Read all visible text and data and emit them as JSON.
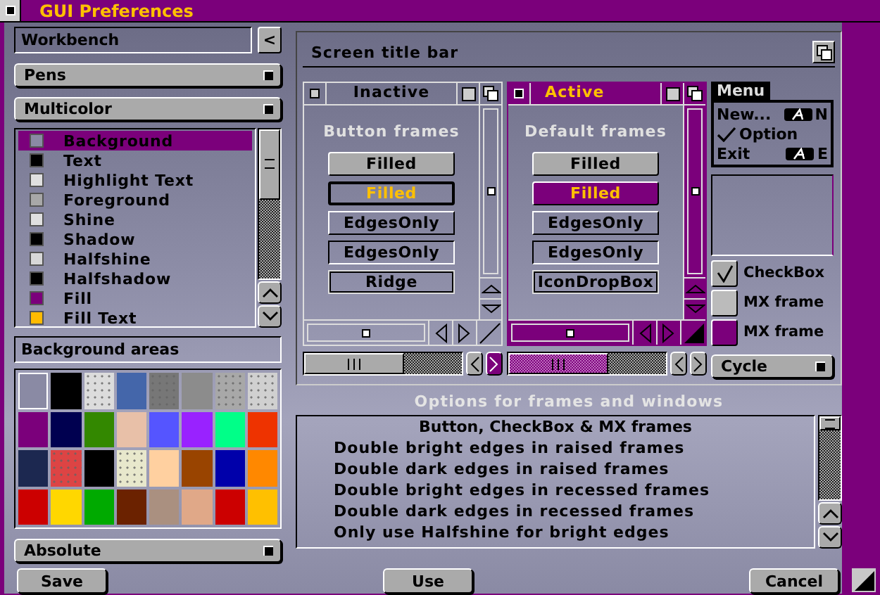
{
  "window": {
    "title": "GUI Preferences"
  },
  "theme": {
    "value": "Workbench",
    "button": "<"
  },
  "pens_cycle": "Pens",
  "mode_cycle": "Multicolor",
  "pens": [
    {
      "name": "Background",
      "color": "#8a8aa4",
      "selected": true
    },
    {
      "name": "Text",
      "color": "#000000",
      "selected": false
    },
    {
      "name": "Highlight Text",
      "color": "#e0e0e0",
      "selected": false
    },
    {
      "name": "Foreground",
      "color": "#a8a8a8",
      "selected": false
    },
    {
      "name": "Shine",
      "color": "#e0e0e0",
      "selected": false
    },
    {
      "name": "Shadow",
      "color": "#000000",
      "selected": false
    },
    {
      "name": "Halfshine",
      "color": "#d8d8d8",
      "selected": false
    },
    {
      "name": "Halfshadow",
      "color": "#000000",
      "selected": false
    },
    {
      "name": "Fill",
      "color": "#7b007b",
      "selected": false
    },
    {
      "name": "Fill Text",
      "color": "#ffbb00",
      "selected": false
    }
  ],
  "background_areas": {
    "label": "Background areas",
    "swatches": [
      {
        "color": "#8a8aa4",
        "dotted": false,
        "selected": true
      },
      {
        "color": "#000000",
        "dotted": false,
        "selected": false
      },
      {
        "color": "#dcdcdc",
        "dotted": true,
        "selected": false
      },
      {
        "color": "#4466aa",
        "dotted": false,
        "selected": false
      },
      {
        "color": "#777777",
        "dotted": true,
        "selected": false
      },
      {
        "color": "#8c8c8c",
        "dotted": false,
        "selected": false
      },
      {
        "color": "#a8a8a8",
        "dotted": true,
        "selected": false
      },
      {
        "color": "#d0d0d0",
        "dotted": true,
        "selected": false
      },
      {
        "color": "#7b007b",
        "dotted": false,
        "selected": false
      },
      {
        "color": "#000050",
        "dotted": false,
        "selected": false
      },
      {
        "color": "#338800",
        "dotted": false,
        "selected": false
      },
      {
        "color": "#e8c0a8",
        "dotted": false,
        "selected": false
      },
      {
        "color": "#5555ff",
        "dotted": false,
        "selected": false
      },
      {
        "color": "#9922ff",
        "dotted": false,
        "selected": false
      },
      {
        "color": "#00ff88",
        "dotted": false,
        "selected": false
      },
      {
        "color": "#ee3300",
        "dotted": false,
        "selected": false
      },
      {
        "color": "#1c2850",
        "dotted": false,
        "selected": false
      },
      {
        "color": "#dd4444",
        "dotted": true,
        "selected": false
      },
      {
        "color": "#000000",
        "dotted": false,
        "selected": false
      },
      {
        "color": "#e8e8cc",
        "dotted": true,
        "selected": false
      },
      {
        "color": "#ffd0a0",
        "dotted": false,
        "selected": false
      },
      {
        "color": "#994400",
        "dotted": false,
        "selected": false
      },
      {
        "color": "#0000aa",
        "dotted": false,
        "selected": false
      },
      {
        "color": "#ff8800",
        "dotted": false,
        "selected": false
      },
      {
        "color": "#cc0000",
        "dotted": false,
        "selected": false
      },
      {
        "color": "#ffd700",
        "dotted": false,
        "selected": false
      },
      {
        "color": "#00aa00",
        "dotted": false,
        "selected": false
      },
      {
        "color": "#6b2200",
        "dotted": false,
        "selected": false
      },
      {
        "color": "#aa9080",
        "dotted": false,
        "selected": false
      },
      {
        "color": "#e0a888",
        "dotted": false,
        "selected": false
      },
      {
        "color": "#cc0000",
        "dotted": false,
        "selected": false
      },
      {
        "color": "#ffc000",
        "dotted": false,
        "selected": false
      }
    ]
  },
  "scale_cycle": "Absolute",
  "screen_title_bar": "Screen title bar",
  "windows": [
    {
      "title": "Inactive",
      "active": false,
      "heading": "Button frames",
      "buttons": [
        {
          "label": "Filled",
          "kind": "filled"
        },
        {
          "label": "Filled",
          "kind": "pressed"
        },
        {
          "label": "EdgesOnly",
          "kind": "raised"
        },
        {
          "label": "EdgesOnly",
          "kind": "recessed"
        },
        {
          "label": "Ridge",
          "kind": "ridge"
        }
      ]
    },
    {
      "title": "Active",
      "active": true,
      "heading": "Default frames",
      "buttons": [
        {
          "label": "Filled",
          "kind": "filled"
        },
        {
          "label": "Filled",
          "kind": "pressed"
        },
        {
          "label": "EdgesOnly",
          "kind": "raised"
        },
        {
          "label": "EdgesOnly",
          "kind": "recessed"
        },
        {
          "label": "IconDropBox",
          "kind": "ridge"
        }
      ]
    }
  ],
  "menu": {
    "title": "Menu",
    "items": [
      {
        "label": "New...",
        "shortcut": "N",
        "checked": false
      },
      {
        "label": "Option",
        "checked": true
      },
      {
        "label": "Exit",
        "shortcut": "E",
        "checked": false
      }
    ]
  },
  "checkbox": {
    "label": "CheckBox",
    "checked": true
  },
  "mx": [
    {
      "label": "MX frame",
      "selected": false
    },
    {
      "label": "MX frame",
      "selected": true
    }
  ],
  "cycle": "Cycle",
  "options": {
    "heading": "Options for frames and windows",
    "list_title": "Button, CheckBox & MX frames",
    "items": [
      "Double bright edges in raised frames",
      "Double dark edges in raised frames",
      "Double bright edges in recessed frames",
      "Double dark edges in recessed frames",
      "Only use Halfshine for bright edges"
    ]
  },
  "buttons": [
    "Save",
    "Use",
    "Cancel"
  ]
}
